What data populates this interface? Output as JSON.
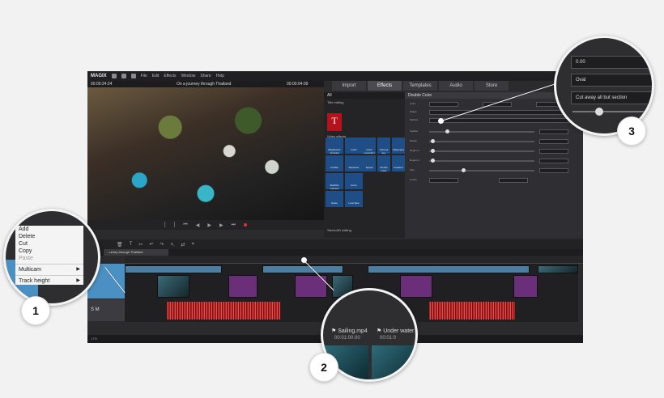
{
  "app": {
    "brand": "MAGIX",
    "menu": [
      "File",
      "Edit",
      "Effects",
      "Window",
      "Share",
      "Help"
    ],
    "project_title": "On a journey through Thailand",
    "timecode_left": "00:00:24:24",
    "timecode_right": "00:00:04:09"
  },
  "tabs": [
    "Import",
    "Effects",
    "Templates",
    "Audio",
    "Store"
  ],
  "active_tab": "Effects",
  "effects": {
    "filter": "All",
    "section_title": "Title editing",
    "title_tile_label": "Title editing",
    "section_video": "Video effects",
    "section_stereo": "Stereo3D editing",
    "tiles": [
      "Brightness/ Contrast",
      "Color",
      "Color correction",
      "Chroma key",
      "Art filter",
      "Distortion",
      "Sharpness",
      "Speed",
      "Stabilize Camera",
      "Zoom",
      "Double Color",
      "Gradient",
      "Noise",
      "Lens flare",
      "Block movement",
      "Sound"
    ]
  },
  "params": {
    "header": "Double Color",
    "rows": [
      "Color",
      "Shape",
      "Method",
      "Feather",
      "Border",
      "Region 1",
      "Region 2",
      "Size",
      "Center"
    ]
  },
  "timeline": {
    "tab_label": "...urney through Thailand",
    "status_text": "17%",
    "track_controls_1": "S M",
    "track_controls_2": "S M"
  },
  "callout1": {
    "menu": {
      "add": "Add",
      "delete": "Delete",
      "cut": "Cut",
      "copy": "Copy",
      "paste": "Paste",
      "multicam": "Multicam",
      "track_height": "Track height"
    },
    "arrow": "▶"
  },
  "callout2": {
    "clip1_name": "Sailing.mp4",
    "clip1_time": "00:01:00:00",
    "clip2_name": "Under water",
    "clip2_time": "00:01:0"
  },
  "callout3": {
    "value_field": "0.00",
    "shape_field": "Oval",
    "method_field": "Cut away all but section"
  },
  "badges": [
    "1",
    "2",
    "3"
  ],
  "colors": {
    "accent_blue": "#4a90c2",
    "clip_purple": "#6b2f7a",
    "audio_red": "#c62828",
    "title_red": "#b5121b"
  }
}
